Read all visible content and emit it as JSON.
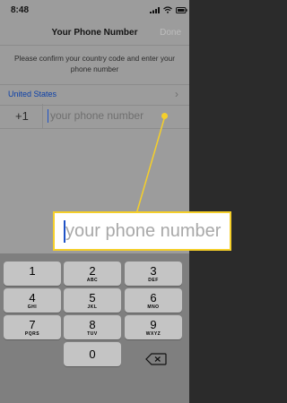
{
  "status": {
    "time": "8:48"
  },
  "nav": {
    "title": "Your Phone Number",
    "done": "Done"
  },
  "instructions": "Please confirm your country code and enter your phone number",
  "country": {
    "name": "United States",
    "code": "+1"
  },
  "phone_input": {
    "placeholder": "your phone number",
    "value": ""
  },
  "callout": {
    "placeholder": "your phone number",
    "accent": "#f5cf2a"
  },
  "keypad": {
    "keys": [
      {
        "num": "1",
        "letters": ""
      },
      {
        "num": "2",
        "letters": "ABC"
      },
      {
        "num": "3",
        "letters": "DEF"
      },
      {
        "num": "4",
        "letters": "GHI"
      },
      {
        "num": "5",
        "letters": "JKL"
      },
      {
        "num": "6",
        "letters": "MNO"
      },
      {
        "num": "7",
        "letters": "PQRS"
      },
      {
        "num": "8",
        "letters": "TUV"
      },
      {
        "num": "9",
        "letters": "WXYZ"
      },
      {
        "num": "0",
        "letters": ""
      }
    ],
    "delete_icon": "delete-backspace-icon"
  }
}
